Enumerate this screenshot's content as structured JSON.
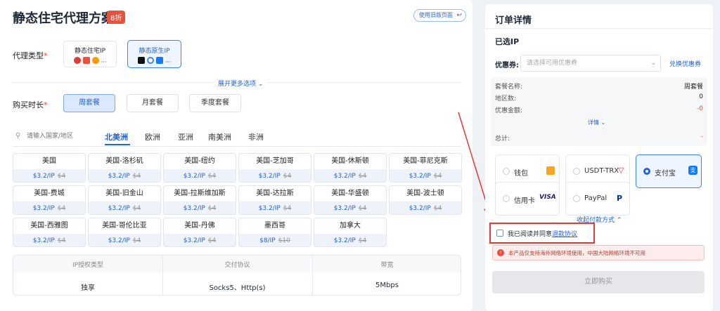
{
  "header": {
    "title": "静态住宅代理方案",
    "badge": "8折",
    "old_version": "使用旧版页面"
  },
  "proxy_type": {
    "label": "代理类型",
    "options": [
      {
        "name": "静态住宅IP"
      },
      {
        "name": "静态原生IP"
      }
    ]
  },
  "expand": "展开更多选项",
  "duration": {
    "label": "购买时长",
    "options": [
      "周套餐",
      "月套餐",
      "季度套餐"
    ]
  },
  "search": {
    "placeholder": "请输入国家/地区"
  },
  "regions": [
    "北美洲",
    "欧洲",
    "亚洲",
    "南美洲",
    "非洲"
  ],
  "cities": [
    {
      "name": "美国",
      "price": "$3.2/IP",
      "old": "$4"
    },
    {
      "name": "美国-洛杉矶",
      "price": "$3.2/IP",
      "old": "$4"
    },
    {
      "name": "美国-纽约",
      "price": "$3.2/IP",
      "old": "$4"
    },
    {
      "name": "美国-芝加哥",
      "price": "$3.2/IP",
      "old": "$4"
    },
    {
      "name": "美国-休斯顿",
      "price": "$3.2/IP",
      "old": "$4"
    },
    {
      "name": "美国-菲尼克斯",
      "price": "$3.2/IP",
      "old": "$4"
    },
    {
      "name": "美国-费城",
      "price": "$3.2/IP",
      "old": "$4"
    },
    {
      "name": "美国-旧金山",
      "price": "$3.2/IP",
      "old": "$4"
    },
    {
      "name": "美国-拉斯维加斯",
      "price": "$3.2/IP",
      "old": "$4"
    },
    {
      "name": "美国-达拉斯",
      "price": "$3.2/IP",
      "old": "$4"
    },
    {
      "name": "美国-华盛顿",
      "price": "$3.2/IP",
      "old": "$4"
    },
    {
      "name": "美国-波士顿",
      "price": "$3.2/IP",
      "old": "$4"
    },
    {
      "name": "美国-西雅图",
      "price": "$3.2/IP",
      "old": "$4"
    },
    {
      "name": "美国-哥伦比亚",
      "price": "$3.2/IP",
      "old": "$4"
    },
    {
      "name": "美国-丹佛",
      "price": "$3.2/IP",
      "old": "$4"
    },
    {
      "name": "墨西哥",
      "price": "$8/IP",
      "old": "$10"
    },
    {
      "name": "加拿大",
      "price": "$3.2/IP",
      "old": "$4"
    }
  ],
  "specs": {
    "headers": [
      "IP授权类型",
      "交付协议",
      "带宽"
    ],
    "values": [
      "独享",
      "Socks5、Http(s)",
      "5Mbps"
    ]
  },
  "order": {
    "title": "订单详情",
    "selected_ip": "已选IP",
    "coupon_label": "优惠券:",
    "coupon_placeholder": "请选择可用优惠券",
    "redeem": "兑换优惠券",
    "rows": [
      {
        "k": "套餐名称:",
        "v": "周套餐"
      },
      {
        "k": "地区数:",
        "v": "0"
      },
      {
        "k": "优惠金额:",
        "v": "-0"
      }
    ],
    "details": "详情",
    "total_label": "总计:",
    "total_value": "-",
    "payments": [
      "钱包",
      "USDT-TRX",
      "支付宝",
      "信用卡",
      "PayPal"
    ],
    "visa": "VISA",
    "collapse": "收起付款方式",
    "agree": "我已阅读并同意",
    "refund": "退款协议",
    "warning": "本产品仅支持海外网络环境使用，中国大陆网络环境不可用",
    "buy": "立即购买"
  },
  "colors": {
    "accent": "#2463d8",
    "warn": "#e74c3c",
    "highlight": "#e53935"
  }
}
